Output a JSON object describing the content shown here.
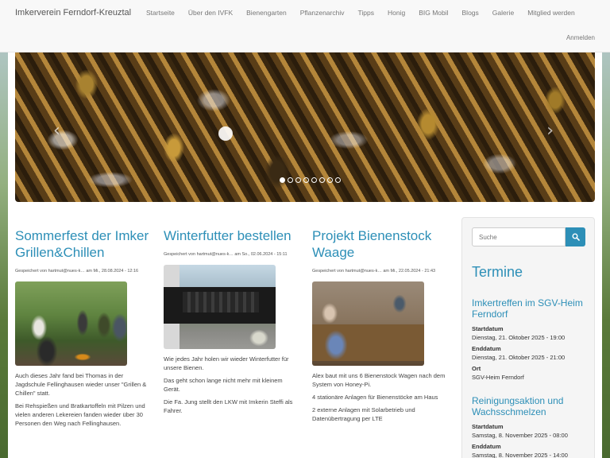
{
  "navbar": {
    "brand": "Imkerverein Ferndorf-Kreuztal",
    "links": [
      "Startseite",
      "Über den IVFK",
      "Bienengarten",
      "Pflanzenarchiv",
      "Tipps",
      "Honig",
      "BIG Mobil",
      "Blogs",
      "Galerie",
      "Mitglied werden"
    ],
    "login": "Anmelden"
  },
  "carousel": {
    "prev_icon": "chevron-left-icon",
    "next_icon": "chevron-right-icon",
    "indicator_count": 8,
    "active_index": 0
  },
  "articles": [
    {
      "title": "Sommerfest der Imker Grillen&Chillen",
      "meta": "Gespeichert von hartmut@nues-k… am Mi., 28.08.2024 - 12:16",
      "paragraphs": [
        "Auch dieses Jahr fand bei Thomas in der Jagdschule Fellinghausen wieder unser \"Grillen & Chillen\" statt.",
        "Bei Rehspießen und Bratkartoffeln mit Pilzen und vielen anderen Lekereien fanden wieder über 30 Personen den Weg nach Fellinghausen."
      ]
    },
    {
      "title": "Winterfutter bestellen",
      "meta": "Gespeichert von hartmut@nues-k… am So., 02.06.2024 - 15:11",
      "paragraphs": [
        "Wie jedes Jahr holen wir wieder Winterfutter für unsere Bienen.",
        "Das geht schon lange nicht mehr mit kleinem Gerät.",
        "Die Fa. Jung stellt den LKW mit Imkerin Steffi als Fahrer."
      ]
    },
    {
      "title": "Projekt Bienenstock Waage",
      "meta": "Gespeichert von hartmut@nues-k… am Mi., 22.05.2024 - 21:43",
      "paragraphs": [
        "Alex baut mit uns 6 Bienenstock Wagen nach dem System von Honey-Pi.",
        "4 stationäre Anlagen für Bienenstöcke am Haus",
        "2 externe Anlagen mit Solarbetrieb und Datenübertragung per LTE"
      ]
    }
  ],
  "sidebar": {
    "search_placeholder": "Suche",
    "search_icon": "search-icon",
    "termine_title": "Termine",
    "events": [
      {
        "title": "Imkertreffen im SGV-Heim Ferndorf",
        "start_label": "Startdatum",
        "start": "Dienstag, 21. Oktober 2025 - 19:00",
        "end_label": "Enddatum",
        "end": "Dienstag, 21. Oktober 2025 - 21:00",
        "place_label": "Ort",
        "place": "SGV-Heim Ferndorf"
      },
      {
        "title": "Reinigungsaktion und Wachsschmelzen",
        "start_label": "Startdatum",
        "start": "Samstag, 8. November 2025 - 08:00",
        "end_label": "Enddatum",
        "end": "Samstag, 8. November 2025 - 14:00"
      }
    ]
  },
  "colors": {
    "accent": "#2d8fb7",
    "navbar_bg": "#f8f8f8",
    "text": "#333333"
  }
}
